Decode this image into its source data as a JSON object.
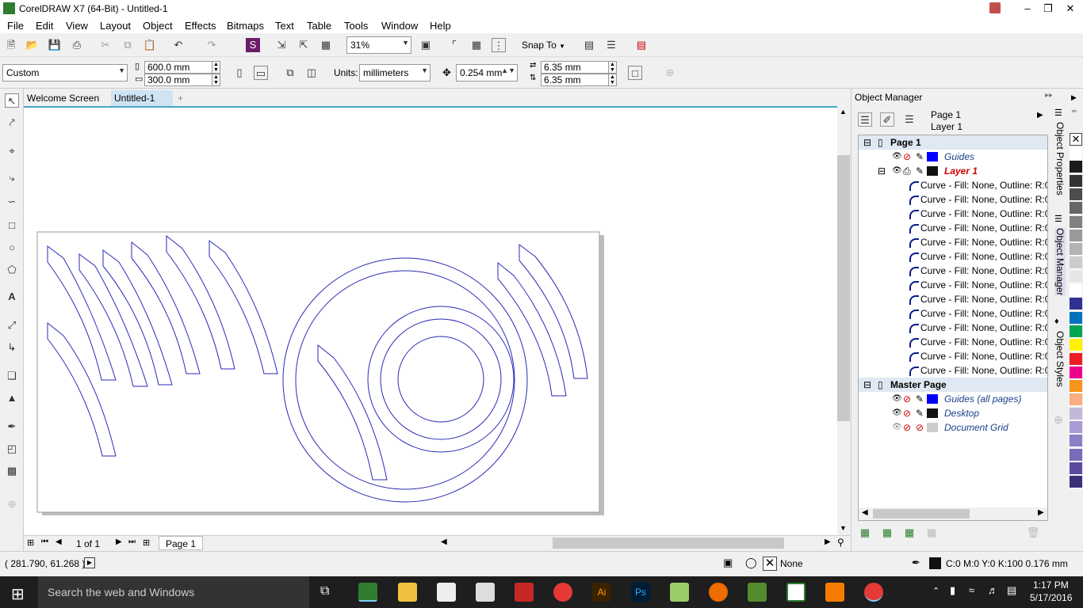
{
  "window": {
    "title": "CorelDRAW X7 (64-Bit) - Untitled-1"
  },
  "menu": [
    "File",
    "Edit",
    "View",
    "Layout",
    "Object",
    "Effects",
    "Bitmaps",
    "Text",
    "Table",
    "Tools",
    "Window",
    "Help"
  ],
  "toolbar": {
    "zoom": "31%",
    "snap_to": "Snap To"
  },
  "property_bar": {
    "page_preset": "Custom",
    "width": "600.0 mm",
    "height": "300.0 mm",
    "units_label": "Units:",
    "units": "millimeters",
    "nudge": "0.254 mm",
    "dup_x": "6.35 mm",
    "dup_y": "6.35 mm"
  },
  "tabs": [
    "Welcome Screen",
    "Untitled-1"
  ],
  "page_nav": {
    "counter": "1 of 1",
    "page_tab": "Page 1"
  },
  "status": {
    "coords": "( 281.790, 61.268 )",
    "fill": "None",
    "outline": "C:0 M:0 Y:0 K:100  0.176 mm"
  },
  "object_manager": {
    "title": "Object Manager",
    "current_page": "Page 1",
    "current_layer": "Layer 1",
    "page1": "Page 1",
    "guides": "Guides",
    "layer1": "Layer 1",
    "curves": [
      "Curve - Fill: None, Outline: R:0",
      "Curve - Fill: None, Outline: R:0",
      "Curve - Fill: None, Outline: R:0",
      "Curve - Fill: None, Outline: R:0",
      "Curve - Fill: None, Outline: R:0",
      "Curve - Fill: None, Outline: R:0",
      "Curve - Fill: None, Outline: R:0",
      "Curve - Fill: None, Outline: R:0",
      "Curve - Fill: None, Outline: R:0",
      "Curve - Fill: None, Outline: R:0",
      "Curve - Fill: None, Outline: R:0",
      "Curve - Fill: None, Outline: R:0",
      "Curve - Fill: None, Outline: R:0",
      "Curve - Fill: None, Outline: R:0"
    ],
    "master_page": "Master Page",
    "master_guides": "Guides (all pages)",
    "desktop": "Desktop",
    "document_grid": "Document Grid"
  },
  "side_tabs": [
    "Object Properties",
    "Object Manager",
    "Object Styles"
  ],
  "palette": [
    "#ffffff",
    "#1a1a1a",
    "#333333",
    "#4d4d4d",
    "#666666",
    "#808080",
    "#999999",
    "#b3b3b3",
    "#cccccc",
    "#e6e6e6",
    "#ffffff",
    "#2e3192",
    "#0072bc",
    "#00a651",
    "#fff200",
    "#ed1c24",
    "#ec008c",
    "#f7941d",
    "#f9ad81",
    "#c2b8d8",
    "#a99bd3",
    "#8c7fc4",
    "#7a6bb8",
    "#5b4a9e",
    "#3c2f7a"
  ],
  "taskbar": {
    "search": "Search the web and Windows",
    "time": "1:17 PM",
    "date": "5/17/2016"
  }
}
